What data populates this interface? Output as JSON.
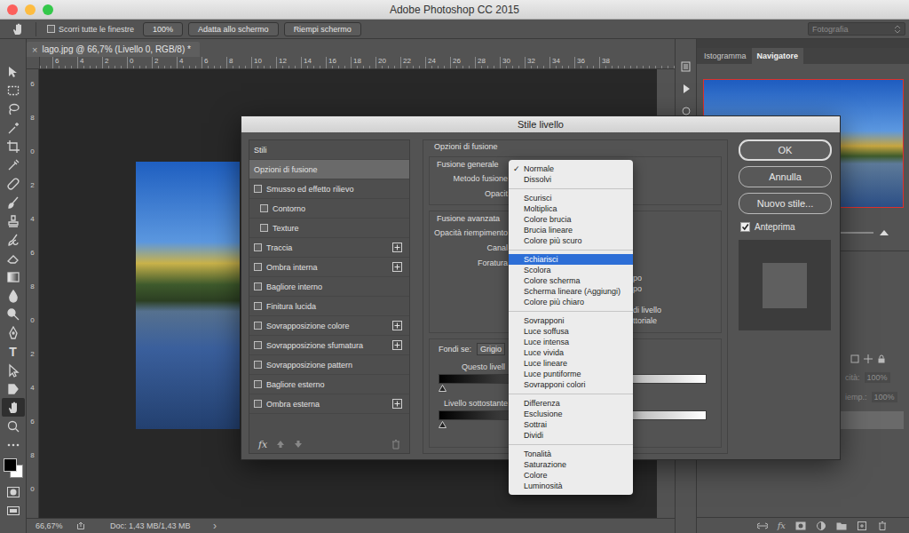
{
  "window": {
    "title": "Adobe Photoshop CC 2015"
  },
  "options_bar": {
    "scroll_all": {
      "label": "Scorri tutte le finestre",
      "checked": false
    },
    "buttons": [
      "100%",
      "Adatta allo schermo",
      "Riempi schermo"
    ],
    "workspace": "Fotografia"
  },
  "toolbar": {
    "tools": [
      {
        "kind": "move",
        "selected": false
      },
      {
        "kind": "marquee",
        "selected": false
      },
      {
        "kind": "lasso",
        "selected": false
      },
      {
        "kind": "wand",
        "selected": false
      },
      {
        "kind": "crop",
        "selected": false
      },
      {
        "kind": "eyedropper",
        "selected": false
      },
      {
        "kind": "heal",
        "selected": false
      },
      {
        "kind": "brush",
        "selected": false
      },
      {
        "kind": "stamp",
        "selected": false
      },
      {
        "kind": "history",
        "selected": false
      },
      {
        "kind": "eraser",
        "selected": false
      },
      {
        "kind": "gradient",
        "selected": false
      },
      {
        "kind": "blur",
        "selected": false
      },
      {
        "kind": "dodge",
        "selected": false
      },
      {
        "kind": "pen",
        "selected": false
      },
      {
        "kind": "type",
        "selected": false,
        "glyph": "T"
      },
      {
        "kind": "path",
        "selected": false
      },
      {
        "kind": "shape",
        "selected": false
      },
      {
        "kind": "hand",
        "selected": true
      },
      {
        "kind": "zoom",
        "selected": false
      },
      {
        "kind": "more",
        "selected": false
      }
    ]
  },
  "document": {
    "tab": {
      "close": "×",
      "title": "lago.jpg @ 66,7% (Livello 0, RGB/8) *"
    },
    "ruler_top": [
      "6",
      "4",
      "2",
      "0",
      "2",
      "4",
      "6",
      "8",
      "10",
      "12",
      "14",
      "16",
      "18",
      "20",
      "22",
      "24",
      "26",
      "28",
      "30",
      "32",
      "34",
      "36",
      "38"
    ],
    "ruler_left": [
      "6",
      "8",
      "0",
      "2",
      "4",
      "6",
      "8",
      "0",
      "2",
      "4",
      "6",
      "8",
      "0"
    ]
  },
  "status_bar": {
    "zoom": "66,67%",
    "doc": "Doc: 1,43 MB/1,43 MB",
    "more": "›"
  },
  "panels": {
    "tabs": [
      {
        "label": "Istogramma",
        "selected": false
      },
      {
        "label": "Navigatore",
        "selected": true
      }
    ],
    "layers": {
      "fields": [
        {
          "label": "cità:",
          "value": "100%",
          "disabled": true
        },
        {
          "label": "iemp.:",
          "value": "100%",
          "disabled": true
        }
      ],
      "footer_fx": "fx"
    }
  },
  "dialog": {
    "title": "Stile livello",
    "styles": {
      "header": "Stili",
      "footer_fx": "fx",
      "items": [
        {
          "label": "Opzioni di fusione",
          "kind": "plain",
          "selected": true,
          "checked": false,
          "indent": false,
          "add": false
        },
        {
          "label": "Smusso ed effetto rilievo",
          "kind": "checkbox",
          "selected": false,
          "checked": false,
          "indent": false,
          "add": false
        },
        {
          "label": "Contorno",
          "kind": "checkbox",
          "selected": false,
          "checked": false,
          "indent": true,
          "add": false
        },
        {
          "label": "Texture",
          "kind": "checkbox",
          "selected": false,
          "checked": false,
          "indent": true,
          "add": false
        },
        {
          "label": "Traccia",
          "kind": "checkbox",
          "selected": false,
          "checked": false,
          "indent": false,
          "add": true
        },
        {
          "label": "Ombra interna",
          "kind": "checkbox",
          "selected": false,
          "checked": false,
          "indent": false,
          "add": true
        },
        {
          "label": "Bagliore interno",
          "kind": "checkbox",
          "selected": false,
          "checked": false,
          "indent": false,
          "add": false
        },
        {
          "label": "Finitura lucida",
          "kind": "checkbox",
          "selected": false,
          "checked": false,
          "indent": false,
          "add": false
        },
        {
          "label": "Sovrapposizione colore",
          "kind": "checkbox",
          "selected": false,
          "checked": false,
          "indent": false,
          "add": true
        },
        {
          "label": "Sovrapposizione sfumatura",
          "kind": "checkbox",
          "selected": false,
          "checked": false,
          "indent": false,
          "add": true
        },
        {
          "label": "Sovrapposizione pattern",
          "kind": "checkbox",
          "selected": false,
          "checked": false,
          "indent": false,
          "add": false
        },
        {
          "label": "Bagliore esterno",
          "kind": "checkbox",
          "selected": false,
          "checked": false,
          "indent": false,
          "add": false
        },
        {
          "label": "Ombra esterna",
          "kind": "checkbox",
          "selected": false,
          "checked": false,
          "indent": false,
          "add": true
        }
      ]
    },
    "blending": {
      "title": "Opzioni di fusione",
      "general": {
        "title": "Fusione generale",
        "labels": [
          "Metodo fusione",
          "Opacit"
        ]
      },
      "advanced": {
        "title": "Fusione avanzata",
        "labels": [
          "Opacità riempimento",
          "Canal",
          "Foratura"
        ],
        "fragments": [
          [
            "po",
            "po"
          ],
          [
            "di livello",
            "ttoriale"
          ]
        ]
      },
      "blend_if": {
        "label": "Fondi se:",
        "channel": "Grigio",
        "this_layer": "Questo livell",
        "under_layer": "Livello sottostante"
      }
    },
    "buttons": [
      {
        "label": "OK",
        "default": true
      },
      {
        "label": "Annulla",
        "default": false
      },
      {
        "label": "Nuovo stile...",
        "default": false
      }
    ],
    "preview": {
      "label": "Anteprima",
      "checked": true
    }
  },
  "blend_menu": {
    "check": "✓",
    "groups": [
      [
        {
          "label": "Normale",
          "checked": true,
          "selected": false
        },
        {
          "label": "Dissolvi",
          "checked": false,
          "selected": false
        }
      ],
      [
        {
          "label": "Scurisci",
          "checked": false,
          "selected": false
        },
        {
          "label": "Moltiplica",
          "checked": false,
          "selected": false
        },
        {
          "label": "Colore brucia",
          "checked": false,
          "selected": false
        },
        {
          "label": "Brucia lineare",
          "checked": false,
          "selected": false
        },
        {
          "label": "Colore più scuro",
          "checked": false,
          "selected": false
        }
      ],
      [
        {
          "label": "Schiarisci",
          "checked": false,
          "selected": true
        },
        {
          "label": "Scolora",
          "checked": false,
          "selected": false
        },
        {
          "label": "Colore scherma",
          "checked": false,
          "selected": false
        },
        {
          "label": "Scherma lineare (Aggiungi)",
          "checked": false,
          "selected": false
        },
        {
          "label": "Colore più chiaro",
          "checked": false,
          "selected": false
        }
      ],
      [
        {
          "label": "Sovrapponi",
          "checked": false,
          "selected": false
        },
        {
          "label": "Luce soffusa",
          "checked": false,
          "selected": false
        },
        {
          "label": "Luce intensa",
          "checked": false,
          "selected": false
        },
        {
          "label": "Luce vivida",
          "checked": false,
          "selected": false
        },
        {
          "label": "Luce lineare",
          "checked": false,
          "selected": false
        },
        {
          "label": "Luce puntiforme",
          "checked": false,
          "selected": false
        },
        {
          "label": "Sovrapponi colori",
          "checked": false,
          "selected": false
        }
      ],
      [
        {
          "label": "Differenza",
          "checked": false,
          "selected": false
        },
        {
          "label": "Esclusione",
          "checked": false,
          "selected": false
        },
        {
          "label": "Sottrai",
          "checked": false,
          "selected": false
        },
        {
          "label": "Dividi",
          "checked": false,
          "selected": false
        }
      ],
      [
        {
          "label": "Tonalità",
          "checked": false,
          "selected": false
        },
        {
          "label": "Saturazione",
          "checked": false,
          "selected": false
        },
        {
          "label": "Colore",
          "checked": false,
          "selected": false
        },
        {
          "label": "Luminosità",
          "checked": false,
          "selected": false
        }
      ]
    ]
  }
}
